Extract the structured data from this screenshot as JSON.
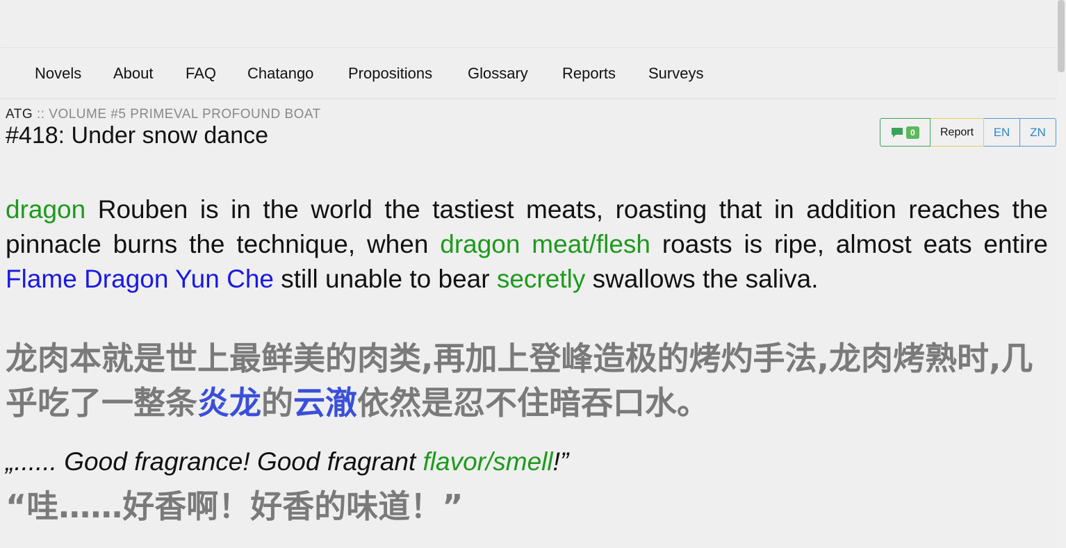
{
  "nav": {
    "items": [
      "Novels",
      "About",
      "FAQ",
      "Chatango",
      "Propositions",
      "Glossary",
      "Reports",
      "Surveys"
    ]
  },
  "breadcrumb": {
    "novel": "ATG",
    "separator": "::",
    "volume": "VOLUME #5 PRIMEVAL PROFOUND BOAT"
  },
  "chapter": {
    "title": "#418: Under snow dance"
  },
  "toolbar": {
    "comment_count": "0",
    "report_label": "Report",
    "en_label": "EN",
    "zn_label": "ZN"
  },
  "content": {
    "p1_en": {
      "t1": "dragon",
      "t2": " Rouben is in the world the tastiest meats, roasting that in addition reaches the pinnacle burns the technique, when ",
      "t3": "dragon meat/flesh",
      "t4": " roasts is ripe, almost eats entire ",
      "t5": "Flame Dragon Yun Che",
      "t6": " still unable to bear ",
      "t7": "secretly",
      "t8": " swallows the saliva."
    },
    "p1_zh": {
      "t1": "龙肉本就是世上最鲜美的肉类,再加上登峰造极的烤灼手法,龙肉烤熟时,几乎吃了一整条",
      "t2": "炎龙",
      "t3": "的",
      "t4": "云澈",
      "t5": "依然是忍不住暗吞口水。"
    },
    "p2_en": {
      "t1": "„...... Good fragrance! Good fragrant ",
      "t2": "flavor/smell",
      "t3": "!”"
    },
    "p2_zh": {
      "t1": "“哇……好香啊！好香的味道！”"
    }
  },
  "colors": {
    "glossary_green": "#1d9a1d",
    "glossary_blue": "#1919e0",
    "chinese_text": "#7a7a7a",
    "background": "#efefef"
  }
}
